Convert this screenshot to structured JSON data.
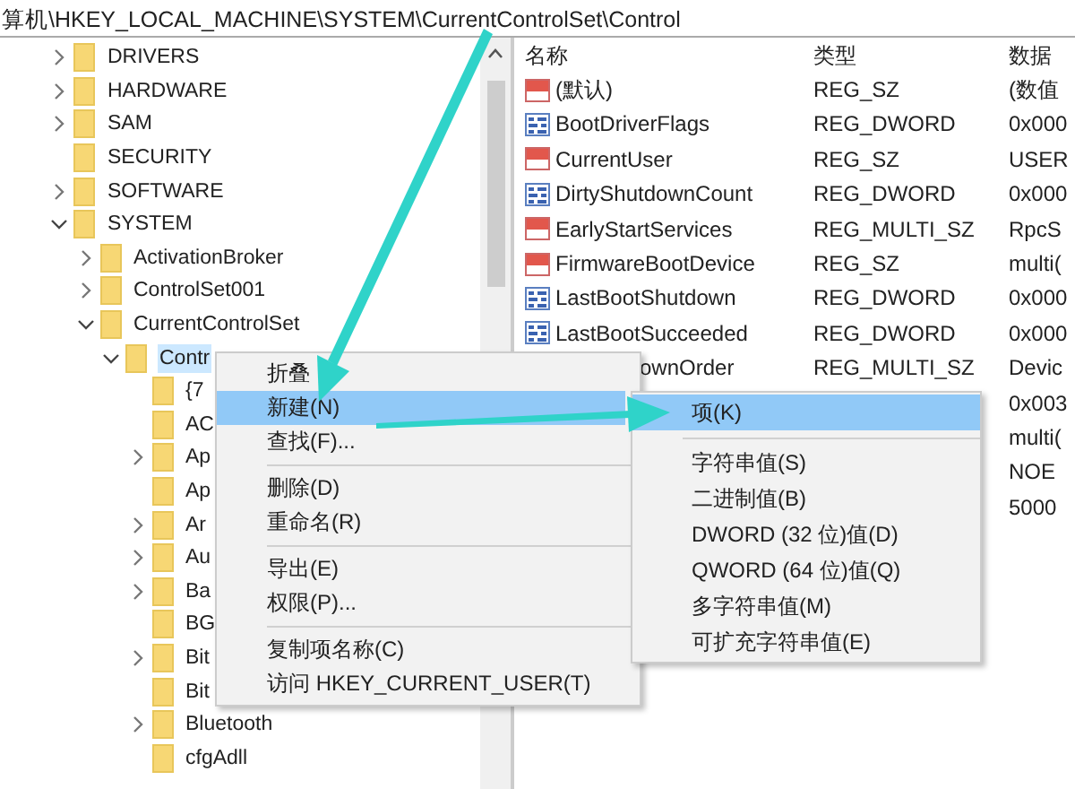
{
  "address_bar": {
    "path": "算机\\HKEY_LOCAL_MACHINE\\SYSTEM\\CurrentControlSet\\Control"
  },
  "tree": [
    {
      "kind": "branch",
      "label": "DRIVERS",
      "expanded": false,
      "selected": false
    },
    {
      "kind": "branch",
      "label": "HARDWARE",
      "expanded": false,
      "selected": false
    },
    {
      "kind": "branch",
      "label": "SAM",
      "expanded": false,
      "selected": false
    },
    {
      "kind": "leaf",
      "label": "SECURITY",
      "selected": false
    },
    {
      "kind": "branch",
      "label": "SOFTWARE",
      "expanded": false,
      "selected": false
    },
    {
      "kind": "branch",
      "label": "SYSTEM",
      "expanded": true,
      "selected": false,
      "children": [
        {
          "kind": "branch",
          "label": "ActivationBroker",
          "expanded": false,
          "selected": false
        },
        {
          "kind": "branch",
          "label": "ControlSet001",
          "expanded": false,
          "selected": false
        },
        {
          "kind": "branch",
          "label": "CurrentControlSet",
          "expanded": true,
          "selected": false,
          "children": [
            {
              "kind": "branch",
              "label": "Contr",
              "expanded": true,
              "selected": true,
              "children": [
                {
                  "kind": "leaf",
                  "label": "{7",
                  "selected": false
                },
                {
                  "kind": "leaf",
                  "label": "AC",
                  "selected": false
                },
                {
                  "kind": "branch",
                  "label": "Ap",
                  "expanded": false,
                  "selected": false
                },
                {
                  "kind": "leaf",
                  "label": "Ap",
                  "selected": false
                },
                {
                  "kind": "branch",
                  "label": "Ar",
                  "expanded": false,
                  "selected": false
                },
                {
                  "kind": "branch",
                  "label": "Au",
                  "expanded": false,
                  "selected": false
                },
                {
                  "kind": "branch",
                  "label": "Ba",
                  "expanded": false,
                  "selected": false
                },
                {
                  "kind": "leaf",
                  "label": "BG",
                  "selected": false
                },
                {
                  "kind": "branch",
                  "label": "Bit",
                  "expanded": false,
                  "selected": false
                },
                {
                  "kind": "leaf",
                  "label": "Bit",
                  "selected": false
                },
                {
                  "kind": "branch",
                  "label": "Bluetooth",
                  "expanded": false,
                  "selected": false
                },
                {
                  "kind": "leaf",
                  "label": "cfgAdll",
                  "selected": false
                }
              ]
            }
          ]
        }
      ]
    }
  ],
  "values_table": {
    "columns": [
      "名称",
      "类型",
      "数据"
    ],
    "rows": [
      {
        "kind": "string",
        "name": "(默认)",
        "type": "REG_SZ",
        "data": "(数值"
      },
      {
        "kind": "binary",
        "name": "BootDriverFlags",
        "type": "REG_DWORD",
        "data": "0x000"
      },
      {
        "kind": "string",
        "name": "CurrentUser",
        "type": "REG_SZ",
        "data": "USER"
      },
      {
        "kind": "binary",
        "name": "DirtyShutdownCount",
        "type": "REG_DWORD",
        "data": "0x000"
      },
      {
        "kind": "string",
        "name": "EarlyStartServices",
        "type": "REG_MULTI_SZ",
        "data": "RpcS"
      },
      {
        "kind": "string",
        "name": "FirmwareBootDevice",
        "type": "REG_SZ",
        "data": "multi("
      },
      {
        "kind": "binary",
        "name": "LastBootShutdown",
        "type": "REG_DWORD",
        "data": "0x000"
      },
      {
        "kind": "binary",
        "name": "LastBootSucceeded",
        "type": "REG_DWORD",
        "data": "0x000"
      },
      {
        "name": "ownOrder",
        "type": "REG_MULTI_SZ",
        "data": "Devic"
      },
      {
        "data": "0x003"
      },
      {
        "data": "multi("
      },
      {
        "data": "NOE"
      },
      {
        "data": "5000"
      }
    ]
  },
  "context_menu": {
    "items": [
      {
        "kind": "item",
        "label": "折叠",
        "selected": false
      },
      {
        "kind": "item",
        "label": "新建(N)",
        "selected": true
      },
      {
        "kind": "item",
        "label": "查找(F)...",
        "selected": false
      },
      {
        "kind": "separator"
      },
      {
        "kind": "item",
        "label": "删除(D)",
        "selected": false
      },
      {
        "kind": "item",
        "label": "重命名(R)",
        "selected": false
      },
      {
        "kind": "separator"
      },
      {
        "kind": "item",
        "label": "导出(E)",
        "selected": false
      },
      {
        "kind": "item",
        "label": "权限(P)...",
        "selected": false
      },
      {
        "kind": "separator"
      },
      {
        "kind": "item",
        "label": "复制项名称(C)",
        "selected": false
      },
      {
        "kind": "item",
        "label": "访问 HKEY_CURRENT_USER(T)",
        "selected": false
      }
    ]
  },
  "submenu": {
    "items": [
      {
        "kind": "item",
        "label": "项(K)",
        "selected": true
      },
      {
        "kind": "separator"
      },
      {
        "kind": "item",
        "label": "字符串值(S)",
        "selected": false
      },
      {
        "kind": "item",
        "label": "二进制值(B)",
        "selected": false
      },
      {
        "kind": "item",
        "label": "DWORD (32 位)值(D)",
        "selected": false
      },
      {
        "kind": "item",
        "label": "QWORD (64 位)值(Q)",
        "selected": false
      },
      {
        "kind": "item",
        "label": "多字符串值(M)",
        "selected": false
      },
      {
        "kind": "item",
        "label": "可扩充字符串值(E)",
        "selected": false
      }
    ]
  }
}
